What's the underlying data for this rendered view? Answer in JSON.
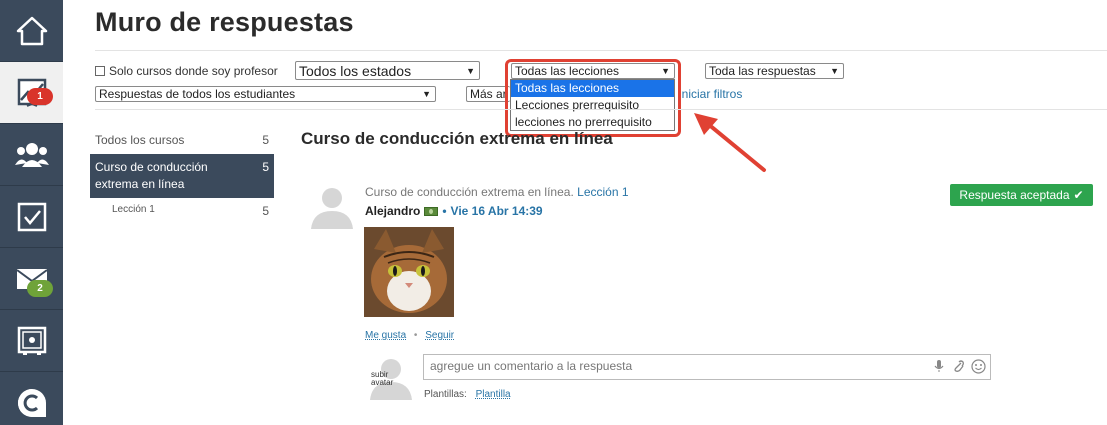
{
  "page": {
    "title": "Muro de respuestas"
  },
  "rail": {
    "items": [
      {
        "icon": "home-icon"
      },
      {
        "icon": "chart-icon",
        "badge": "1"
      },
      {
        "icon": "group-icon"
      },
      {
        "icon": "checkbox-icon"
      },
      {
        "icon": "mail-icon",
        "badge": "2"
      },
      {
        "icon": "safe-icon"
      },
      {
        "icon": "chat-icon"
      }
    ]
  },
  "filters": {
    "only_my_courses": "Solo cursos donde soy profesor",
    "states": "Todos los estados",
    "lessons": "Todas las lecciones",
    "answers": "Toda las respuestas",
    "students": "Respuestas de todos los estudiantes",
    "more_prefix": "Más ar",
    "reset": "iniciar filtros",
    "lesson_options": [
      "Todas las lecciones",
      "Lecciones prerrequisito",
      "lecciones no prerrequisito"
    ]
  },
  "sidebar": {
    "all_label": "Todos los cursos",
    "all_count": "5",
    "course_label": "Curso de conducción extrema en línea",
    "course_count": "5",
    "lesson_label": "Lección 1",
    "lesson_count": "5"
  },
  "main": {
    "course_title": "Curso de conducción extrema en línea",
    "post": {
      "context": "Curso de conducción extrema en línea.",
      "lesson_link": "Lección 1",
      "author": "Alejandro",
      "date": "Vie 16 Abr 14:39",
      "status": "Respuesta aceptada",
      "like": "Me gusta",
      "follow": "Seguir"
    },
    "comment": {
      "upload_avatar": "subir avatar",
      "placeholder": "agregue un comentario a la respuesta",
      "templates_label": "Plantillas:",
      "template_link": "Plantilla"
    }
  },
  "colors": {
    "rail": "#3b4a5c",
    "accent_blue": "#2874a6",
    "accepted_green": "#2da44e",
    "highlight_red": "#e04133",
    "badge_red": "#d9342b",
    "badge_green": "#6fa339"
  }
}
